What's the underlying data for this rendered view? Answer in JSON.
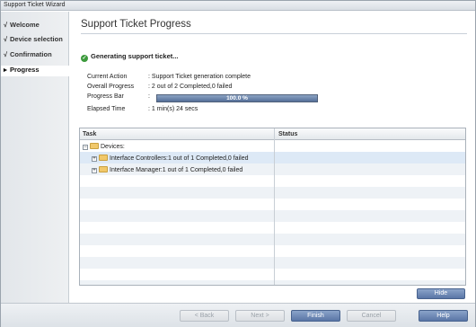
{
  "window": {
    "title": "Support Ticket Wizard"
  },
  "sidebar": {
    "items": [
      {
        "label": "Welcome",
        "mark": "√"
      },
      {
        "label": "Device selection",
        "mark": "√"
      },
      {
        "label": "Confirmation",
        "mark": "√"
      },
      {
        "label": "Progress",
        "mark": "▸"
      }
    ]
  },
  "main": {
    "title": "Support Ticket Progress",
    "status_heading": "Generating support ticket...",
    "info": [
      {
        "label": "Current Action",
        "value": ":  Support Ticket generation complete"
      },
      {
        "label": "Overall Progress",
        "value": ":  2 out of 2 Completed,0 failed"
      },
      {
        "label": "Progress Bar",
        "value": ":"
      },
      {
        "label": "Elapsed Time",
        "value": ":  1 min(s) 24 secs"
      }
    ],
    "progress": {
      "percent": 100,
      "text": "100.0 %"
    }
  },
  "table": {
    "columns": [
      "Task",
      "Status"
    ],
    "rows": [
      {
        "task": "Devices:",
        "status": "",
        "level": 0,
        "expander": "−"
      },
      {
        "task": "Interface Controllers:1  out of 1 Completed,0 failed",
        "status": "",
        "level": 1,
        "expander": "+"
      },
      {
        "task": "Interface Manager:1  out of 1 Completed,0 failed",
        "status": "",
        "level": 1,
        "expander": "+"
      }
    ]
  },
  "buttons": {
    "hide": "Hide",
    "back": "< Back",
    "next": "Next >",
    "finish": "Finish",
    "cancel": "Cancel",
    "help": "Help"
  },
  "colors": {
    "accent": "#5a76a6",
    "success": "#3c9a3c",
    "selected_row": "#dde9f6"
  }
}
